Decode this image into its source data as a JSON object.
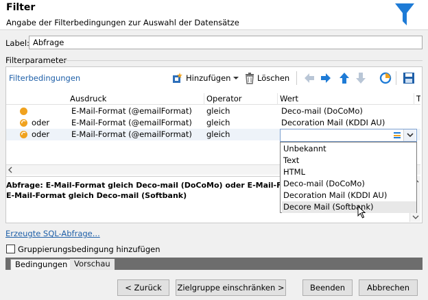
{
  "header": {
    "title": "Filter",
    "subtitle": "Angabe der Filterbedingungen zur Auswahl der Datensätze",
    "icon": "funnel-icon"
  },
  "label_field": {
    "label": "Label:",
    "value": "Abfrage"
  },
  "params_legend": "Filterparameter",
  "filter_link": "Filterbedingungen",
  "toolbar": {
    "add_label": "Hinzufügen",
    "delete_label": "Löschen"
  },
  "grid": {
    "columns": [
      "Ausdruck",
      "Operator",
      "Wert",
      "T"
    ],
    "rows": [
      {
        "logic": "",
        "expression": "E-Mail-Format (@emailFormat)",
        "operator": "gleich",
        "value": "Deco-mail (DoCoMo)"
      },
      {
        "logic": "oder",
        "expression": "E-Mail-Format (@emailFormat)",
        "operator": "gleich",
        "value": "Decoration Mail (KDDI AU)"
      },
      {
        "logic": "oder",
        "expression": "E-Mail-Format (@emailFormat)",
        "operator": "gleich",
        "value": ""
      }
    ]
  },
  "dropdown": {
    "options": [
      "Unbekannt",
      "Text",
      "HTML",
      "Deco-mail (DoCoMo)",
      "Decoration Mail (KDDI AU)",
      "Decore Mail (Softbank)"
    ],
    "highlighted": 5
  },
  "summary": {
    "line1": "Abfrage: E-Mail-Format gleich Deco-mail (DoCoMo) oder E-Mail-Format",
    "line2": "E-Mail-Format gleich Deco-mail (Softbank)"
  },
  "sql_link": "Erzeugte SQL-Abfrage...",
  "grouping_label": "Gruppierungsbedingung hinzufügen",
  "tabs": [
    "Bedingungen",
    "Vorschau"
  ],
  "buttons": {
    "back": "< Zurück",
    "target": "Zielgruppe einschränken >",
    "finish": "Beenden",
    "cancel": "Abbrechen"
  },
  "colors": {
    "accent": "#1e7bd6",
    "link": "#1e5fa8",
    "bullet": "#f0a21e"
  }
}
